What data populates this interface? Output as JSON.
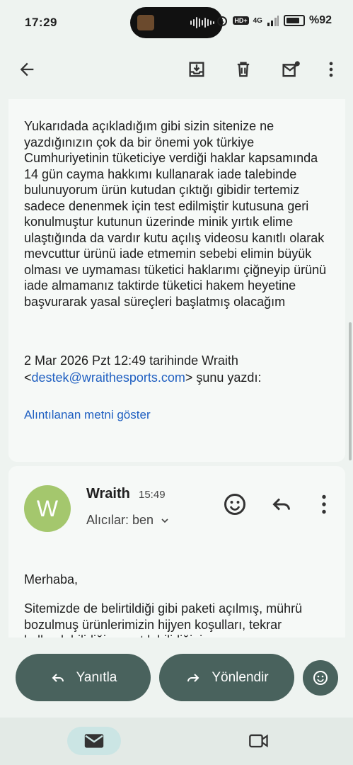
{
  "status": {
    "time": "17:29",
    "network": "4G",
    "hd": "HD+",
    "battery": "%92"
  },
  "toolbar": {
    "back": "arrow-back-icon",
    "archive": "archive-icon",
    "delete": "trash-icon",
    "mark_unread": "mark-unread-icon",
    "more": "more-vert-icon"
  },
  "message1": {
    "body": "Yukarıdada açıkladığım gibi sizin sitenize ne yazdığınızın çok da bir önemi yok türkiye Cumhuriyetinin tüketiciye verdiği haklar kapsamında 14 gün cayma hakkımı kullanarak iade talebinde bulunuyorum ürün kutudan çıktığı gibidir tertemiz sadece denenmek için test edilmiştir kutusuna geri konulmuştur kutunun üzerinde minik yırtık elime ulaştığında da vardır kutu açılış videosu kanıtlı olarak mevcuttur ürünü iade etmemin sebebi elimin büyük olması ve uymaması tüketici haklarımı çiğneyip ürünü iade almamanız taktirde tüketici hakem heyetine başvurarak yasal süreçleri başlatmış olacağım",
    "quote_prefix": "2 Mar 2026 Pzt 12:49 tarihinde Wraith <",
    "quote_email": "destek@wraithesports.com",
    "quote_suffix": "> şunu yazdı:",
    "show_quoted": "Alıntılanan metni göster"
  },
  "message2": {
    "avatar_letter": "W",
    "sender": "Wraith",
    "time": "15:49",
    "recipients": "Alıcılar: ben",
    "greeting": "Merhaba,",
    "body": "Sitemizde de belirtildiği gibi paketi açılmış, mührü bozulmuş ürünlerimizin hijyen koşulları, tekrar kullanılabilirliği ve satılabilirliğini"
  },
  "actions": {
    "reply": "Yanıtla",
    "forward": "Yönlendir"
  },
  "colors": {
    "accent": "#49625d",
    "link": "#1f5fc1",
    "avatar": "#a4c76d",
    "nav_active": "#cbe5e4"
  }
}
